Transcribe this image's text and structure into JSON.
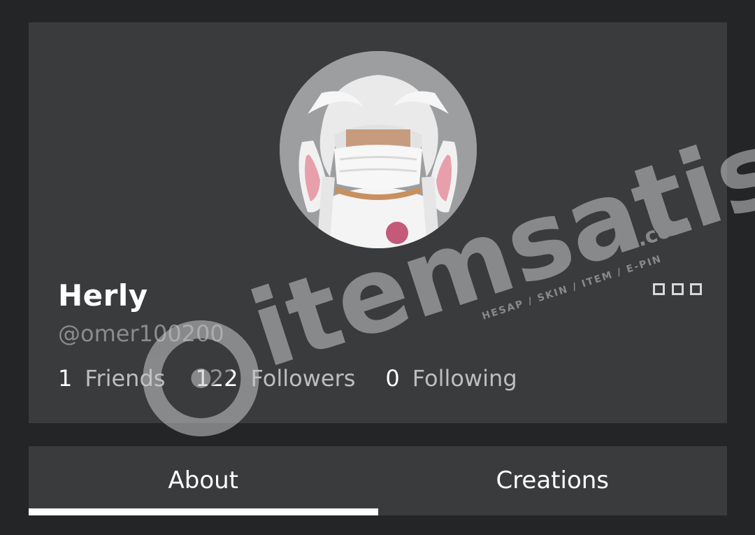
{
  "profile": {
    "display_name": "Herly",
    "username": "@omer100200",
    "avatar_icon": "avatar-image",
    "more_icon": "more-options-icon"
  },
  "stats": [
    {
      "count": "1",
      "label": "Friends"
    },
    {
      "count": "122",
      "label": "Followers"
    },
    {
      "count": "0",
      "label": "Following"
    }
  ],
  "tabs": [
    {
      "label": "About",
      "active": true
    },
    {
      "label": "Creations",
      "active": false
    }
  ],
  "watermark": {
    "brand": "itemsatis",
    "domain": ".com",
    "tagline": "HESAP / SKIN / ITEM / E-PIN"
  },
  "colors": {
    "background": "#232527",
    "card": "#393b3d",
    "text_primary": "#ffffff",
    "text_secondary": "#bdbec0",
    "text_muted": "#8a8c8e"
  }
}
